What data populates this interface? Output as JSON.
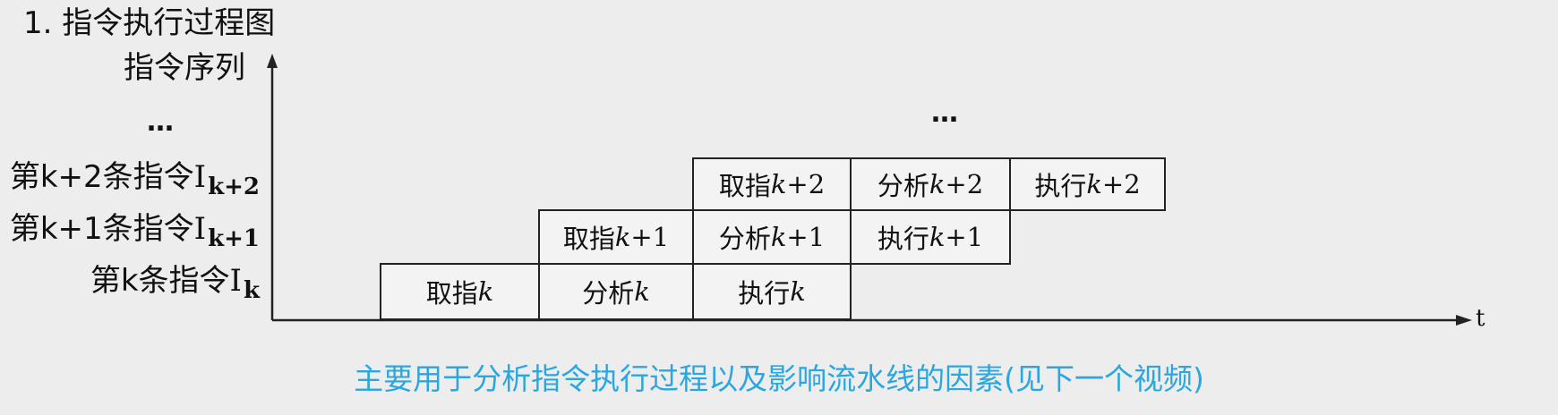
{
  "title": "1. 指令执行过程图",
  "y_axis_label": "指令序列",
  "x_axis_label": "t",
  "ellipsis_left": "…",
  "ellipsis_top": "…",
  "rows": [
    {
      "prefix": "第k+2条指令",
      "roman": "I",
      "sub": "k+2"
    },
    {
      "prefix": "第k+1条指令",
      "roman": "I",
      "sub": "k+1"
    },
    {
      "prefix": "第k条指令",
      "roman": "I",
      "sub": "k"
    }
  ],
  "stages": {
    "fetch_k": {
      "cn": "取指",
      "k": "k",
      "n": ""
    },
    "analyze_k": {
      "cn": "分析",
      "k": "k",
      "n": ""
    },
    "exec_k": {
      "cn": "执行",
      "k": "k",
      "n": ""
    },
    "fetch_k1": {
      "cn": "取指",
      "k": "k",
      "n": "+1"
    },
    "analyze_k1": {
      "cn": "分析",
      "k": "k",
      "n": "+1"
    },
    "exec_k1": {
      "cn": "执行",
      "k": "k",
      "n": "+1"
    },
    "fetch_k2": {
      "cn": "取指",
      "k": "k",
      "n": "+2"
    },
    "analyze_k2": {
      "cn": "分析",
      "k": "k",
      "n": "+2"
    },
    "exec_k2": {
      "cn": "执行",
      "k": "k",
      "n": "+2"
    }
  },
  "caption": "主要用于分析指令执行过程以及影响流水线的因素(见下一个视频)",
  "colors": {
    "caption": "#2aa6e0",
    "background": "#ededed",
    "line": "#222222"
  }
}
